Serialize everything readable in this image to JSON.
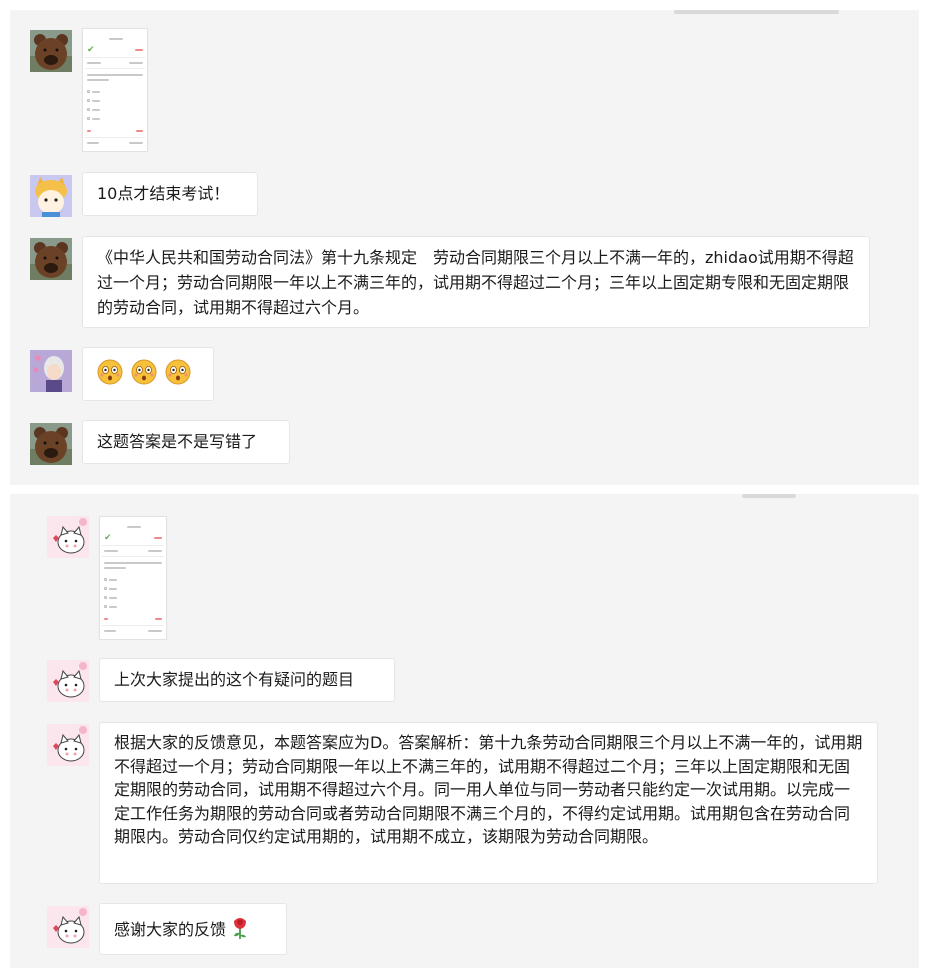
{
  "chat_top": {
    "messages": [
      {
        "type": "image",
        "sender_avatar": "bear-avatar"
      },
      {
        "type": "text",
        "sender_avatar": "cat-hat-avatar",
        "text": "10点才结束考试！"
      },
      {
        "type": "text",
        "sender_avatar": "bear-avatar",
        "text": "《中华人民共和国劳动合同法》第十九条规定　劳动合同期限三个月以上不满一年的，zhidao试用期不得超过一个月；劳动合同期限一年以上不满三年的，试用期不得超过二个月；三年以上固定期专限和无固定期限的劳动合同，试用期不得超过六个月。"
      },
      {
        "type": "emoji",
        "sender_avatar": "anime-avatar",
        "emoji": [
          "surprised-face-emoji",
          "surprised-face-emoji",
          "surprised-face-emoji"
        ]
      },
      {
        "type": "text",
        "sender_avatar": "bear-avatar",
        "text": "这题答案是不是写错了"
      }
    ]
  },
  "chat_bottom": {
    "messages": [
      {
        "type": "image",
        "sender_avatar": "cartoon-cat-avatar"
      },
      {
        "type": "text",
        "sender_avatar": "cartoon-cat-avatar",
        "text": "上次大家提出的这个有疑问的题目"
      },
      {
        "type": "text",
        "sender_avatar": "cartoon-cat-avatar",
        "text": "根据大家的反馈意见，本题答案应为D。答案解析：第十九条劳动合同期限三个月以上不满一年的，试用期不得超过一个月；劳动合同期限一年以上不满三年的，试用期不得超过二个月；三年以上固定期限和无固定期限的劳动合同，试用期不得超过六个月。同一用人单位与同一劳动者只能约定一次试用期。以完成一定工作任务为期限的劳动合同或者劳动合同期限不满三个月的，不得约定试用期。试用期包含在劳动合同期限内。劳动合同仅约定试用期的，试用期不成立，该期限为劳动合同期限。"
      },
      {
        "type": "text",
        "sender_avatar": "cartoon-cat-avatar",
        "text": "感谢大家的反馈",
        "emoji": "rose-emoji"
      }
    ]
  },
  "colors": {
    "panel_background": "#f4f4f4",
    "bubble_background": "#ffffff",
    "bubble_border": "#e6e6e6",
    "bear_fur": "#6b4226",
    "emoji_face": "#f7c23b"
  }
}
